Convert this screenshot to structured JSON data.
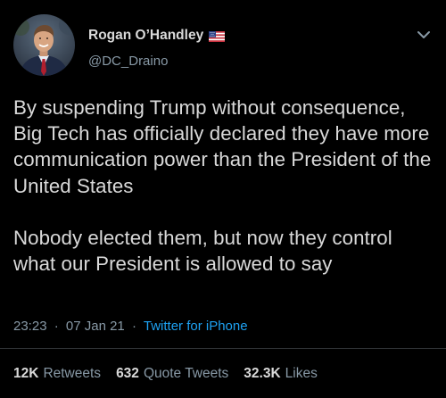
{
  "author": {
    "display_name": "Rogan O’Handley",
    "handle": "@DC_Draino",
    "badge_icon": "us-flag-icon",
    "menu_icon": "chevron-down-icon"
  },
  "tweet": {
    "paragraphs": [
      "By suspending Trump without consequence, Big Tech has officially declared they have more communication power than the President of the United States",
      "Nobody elected them, but now they control what our President is allowed to say"
    ],
    "time": "23:23",
    "separator": "·",
    "date": "07 Jan 21",
    "source": "Twitter for iPhone"
  },
  "stats": {
    "retweets": {
      "count": "12K",
      "label": "Retweets"
    },
    "quote_tweets": {
      "count": "632",
      "label": "Quote Tweets"
    },
    "likes": {
      "count": "32.3K",
      "label": "Likes"
    }
  },
  "colors": {
    "background": "#000000",
    "text_primary": "#d9d9d9",
    "text_secondary": "#8899a6",
    "link": "#1da1f2",
    "divider": "#2f3336"
  }
}
